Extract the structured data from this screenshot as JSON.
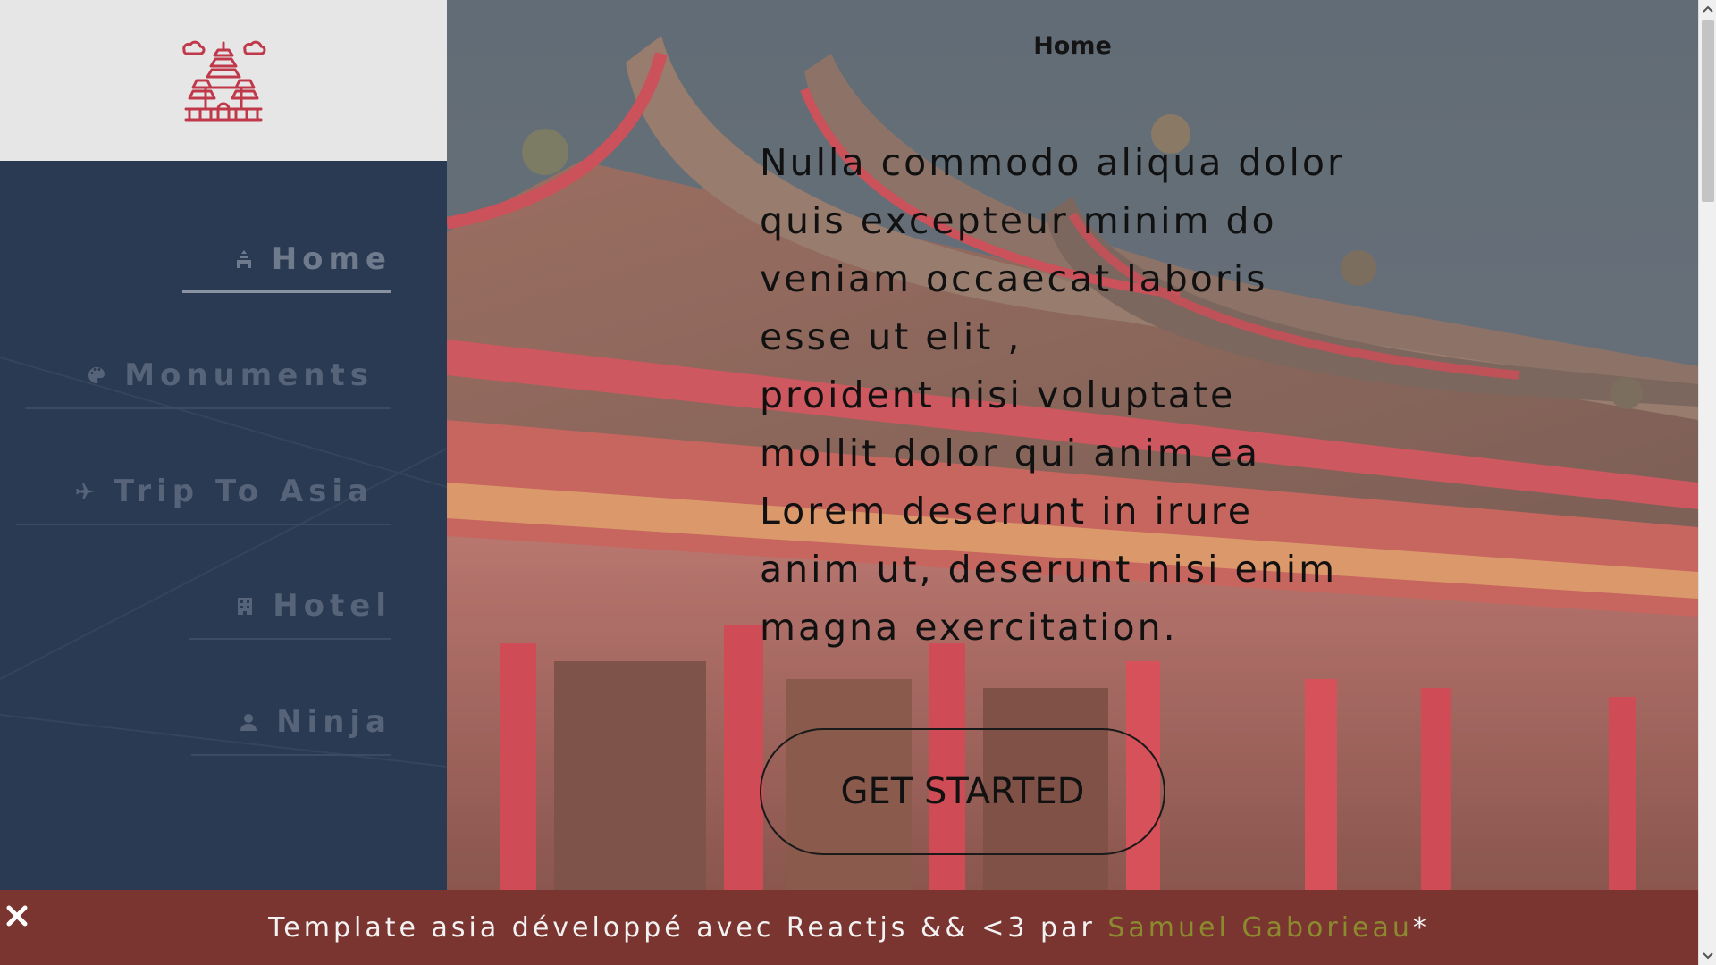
{
  "sidebar": {
    "logo_icon": "temple-logo-icon",
    "items": [
      {
        "label": "Home",
        "icon": "temple-icon",
        "active": true
      },
      {
        "label": "Monuments",
        "icon": "palette-icon",
        "active": false
      },
      {
        "label": "Trip To Asia",
        "icon": "airplane-icon",
        "active": false
      },
      {
        "label": "Hotel",
        "icon": "building-icon",
        "active": false
      },
      {
        "label": "Ninja",
        "icon": "user-icon",
        "active": false
      }
    ]
  },
  "main": {
    "title": "Home",
    "paragraph_1": "Nulla commodo aliqua dolor quis excepteur minim do veniam occaecat laboris esse ut elit ,",
    "paragraph_2": "proident nisi voluptate mollit dolor qui anim ea Lorem deserunt in irure anim ut, deserunt nisi enim magna exercitation.",
    "cta_label": "GET STARTED"
  },
  "footer": {
    "text": "Template asia développé avec Reactjs && <3 par ",
    "author": "Samuel Gaborieau",
    "suffix": "*",
    "close_icon": "close-icon"
  },
  "colors": {
    "sidebar_bg": "#2a3a52",
    "logo_bg": "#e6e6e6",
    "logo_red": "#c0394b",
    "footer_bg": "#7b3530",
    "author_color": "#8c8a2e"
  }
}
